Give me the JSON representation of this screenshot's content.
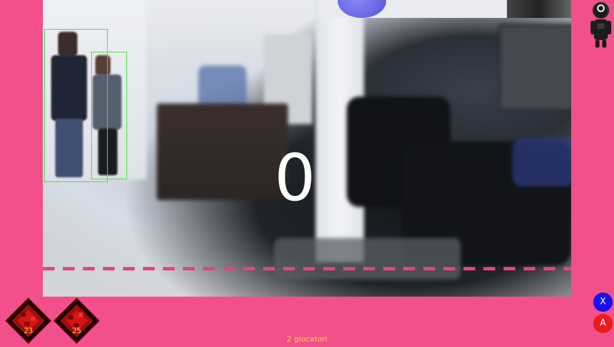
{
  "game": {
    "countdown": "0",
    "players_text": "2 giocatori"
  },
  "controls": {
    "x_button_label": "X",
    "a_button_label": "A"
  },
  "players": [
    {
      "label": "23"
    },
    {
      "label": "25"
    }
  ],
  "colors": {
    "background": "#f2508a",
    "detection_box": "#3de63d",
    "finish_line": "#e8418a",
    "x_button": "#1612f0",
    "a_button": "#ec1b1b",
    "badge_text": "#ffd24a"
  },
  "icons": {
    "guard": "squid-game-guard-icon"
  }
}
